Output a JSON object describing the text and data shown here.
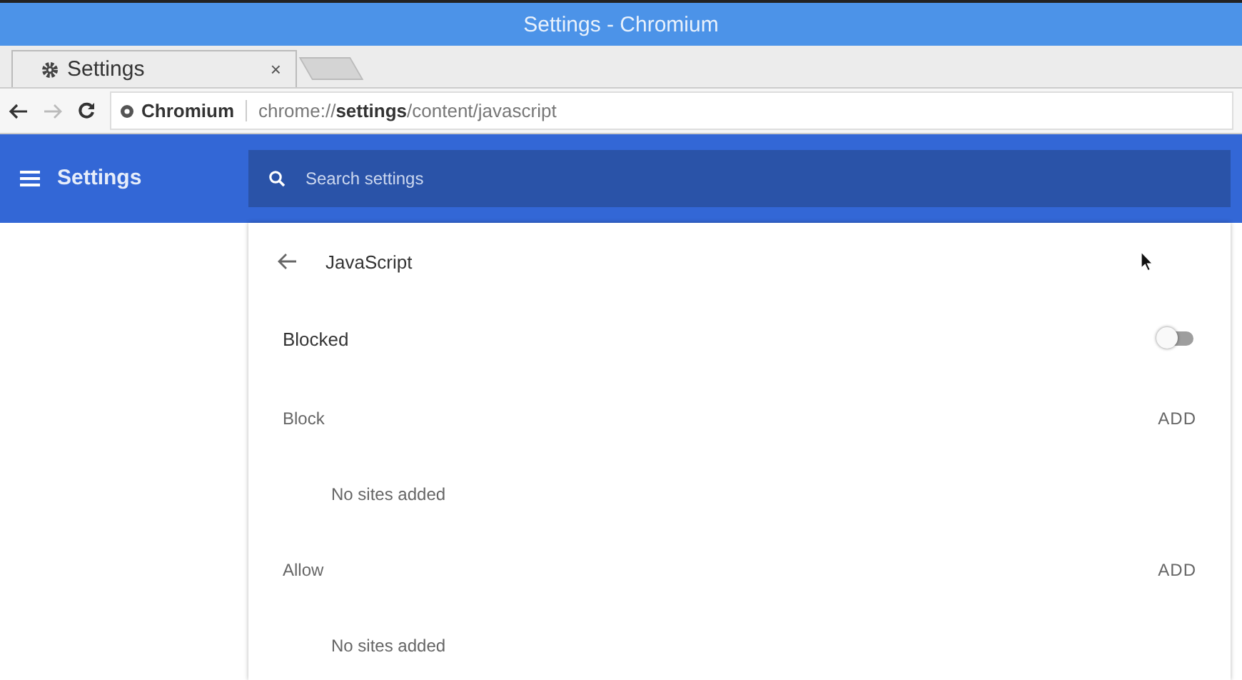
{
  "window": {
    "title": "Settings - Chromium"
  },
  "tabs": [
    {
      "label": "Settings",
      "close": "×"
    }
  ],
  "toolbar": {
    "site_name": "Chromium",
    "url": "chrome://**settings**/content/javascript"
  },
  "header": {
    "title": "Settings",
    "search": {
      "placeholder": "Search settings"
    }
  },
  "page": {
    "title": "JavaScript",
    "setting": {
      "label": "Blocked",
      "on": false
    },
    "sections": [
      {
        "label": "Block",
        "action": "ADD",
        "empty": "No sites added"
      },
      {
        "label": "Allow",
        "action": "ADD",
        "empty": "No sites added"
      }
    ]
  }
}
